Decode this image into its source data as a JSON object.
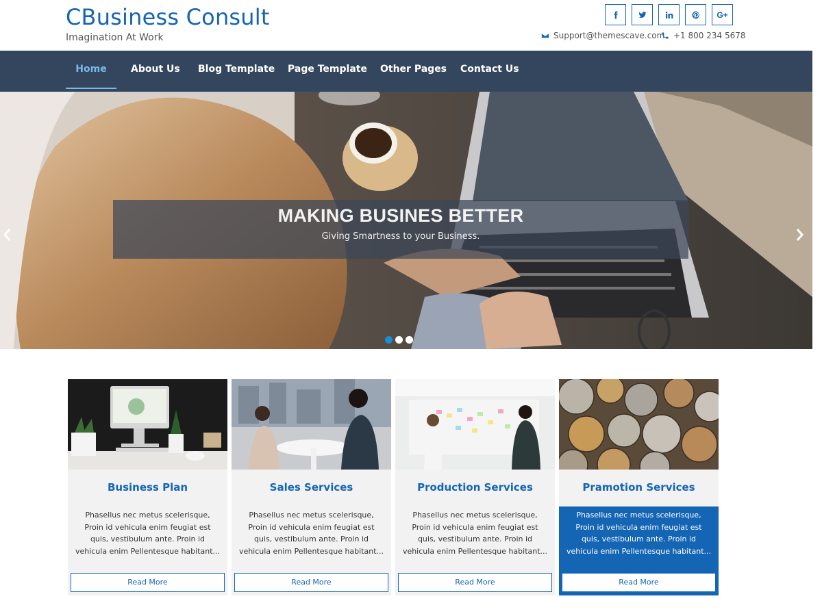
{
  "site": {
    "title": "CBusiness Consult",
    "tagline": "Imagination At Work"
  },
  "social": [
    {
      "icon": "facebook-icon",
      "glyph": "f"
    },
    {
      "icon": "twitter-icon",
      "glyph": ""
    },
    {
      "icon": "linkedin-icon",
      "glyph": "in"
    },
    {
      "icon": "pinterest-icon",
      "glyph": ""
    },
    {
      "icon": "google-plus-icon",
      "glyph": "G+"
    }
  ],
  "contact": {
    "email": "Support@themescave.com",
    "phone": "+1 800 234 5678"
  },
  "nav": {
    "items": [
      {
        "label": "Home",
        "active": true
      },
      {
        "label": "About Us"
      },
      {
        "label": "Blog Template"
      },
      {
        "label": "Page Template"
      },
      {
        "label": "Other Pages"
      },
      {
        "label": "Contact Us"
      }
    ]
  },
  "hero": {
    "title": "MAKING BUSINES BETTER",
    "subtitle": "Giving Smartness to your Business.",
    "slide_count": 3,
    "active_slide": 1
  },
  "services": [
    {
      "title": "Business Plan",
      "text": "Phasellus nec metus scelerisque, Proin id vehicula enim feugiat est quis, vestibulum ante. Proin id vehicula enim Pellentesque habitant...",
      "button": "Read More"
    },
    {
      "title": "Sales Services",
      "text": "Phasellus nec metus scelerisque, Proin id vehicula enim feugiat est quis, vestibulum ante. Proin id vehicula enim Pellentesque habitant...",
      "button": "Read More"
    },
    {
      "title": "Production Services",
      "text": "Phasellus nec metus scelerisque, Proin id vehicula enim feugiat est quis, vestibulum ante. Proin id vehicula enim Pellentesque habitant...",
      "button": "Read More"
    },
    {
      "title": "Pramotion Services",
      "text": "Phasellus nec metus scelerisque, Proin id vehicula enim feugiat est quis, vestibulum ante. Proin id vehicula enim Pellentesque habitant...",
      "button": "Read More",
      "highlighted": true
    }
  ],
  "colors": {
    "brand_blue": "#1565b5",
    "nav_bg": "#34465d",
    "nav_active": "#7ab8ec",
    "card_bg": "#f3f2f2"
  }
}
